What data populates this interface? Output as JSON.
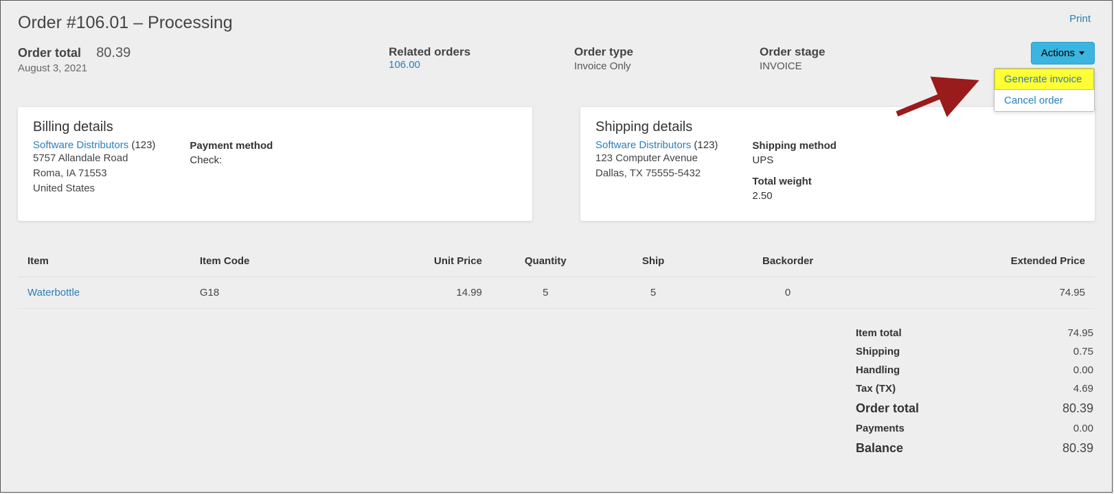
{
  "header": {
    "title": "Order #106.01 – Processing",
    "print": "Print"
  },
  "summary": {
    "order_total_label": "Order total",
    "order_total_value": "80.39",
    "order_date": "August 3, 2021",
    "related_label": "Related orders",
    "related_link": "106.00",
    "type_label": "Order type",
    "type_value": "Invoice Only",
    "stage_label": "Order stage",
    "stage_value": "INVOICE"
  },
  "actions": {
    "button": "Actions",
    "generate_invoice": "Generate invoice",
    "cancel_order": "Cancel order"
  },
  "billing": {
    "heading": "Billing details",
    "company": "Software Distributors",
    "company_code": "(123)",
    "line1": "5757 Allandale Road",
    "line2": "Roma, IA 71553",
    "line3": "United States",
    "payment_method_label": "Payment method",
    "payment_method_value": "Check:"
  },
  "shipping": {
    "heading": "Shipping details",
    "company": "Software Distributors",
    "company_code": "(123)",
    "line1": "123 Computer Avenue",
    "line2": "Dallas, TX 75555-5432",
    "ship_method_label": "Shipping method",
    "ship_method_value": "UPS",
    "weight_label": "Total weight",
    "weight_value": "2.50"
  },
  "items": {
    "headers": {
      "item": "Item",
      "code": "Item Code",
      "unit": "Unit Price",
      "qty": "Quantity",
      "ship": "Ship",
      "back": "Backorder",
      "ext": "Extended Price"
    },
    "rows": [
      {
        "name": "Waterbottle",
        "code": "G18",
        "unit": "14.99",
        "qty": "5",
        "ship": "5",
        "back": "0",
        "ext": "74.95"
      }
    ]
  },
  "totals": {
    "item_total_label": "Item total",
    "item_total": "74.95",
    "shipping_label": "Shipping",
    "shipping": "0.75",
    "handling_label": "Handling",
    "handling": "0.00",
    "tax_label": "Tax (TX)",
    "tax": "4.69",
    "order_total_label": "Order total",
    "order_total": "80.39",
    "payments_label": "Payments",
    "payments": "0.00",
    "balance_label": "Balance",
    "balance": "80.39"
  }
}
